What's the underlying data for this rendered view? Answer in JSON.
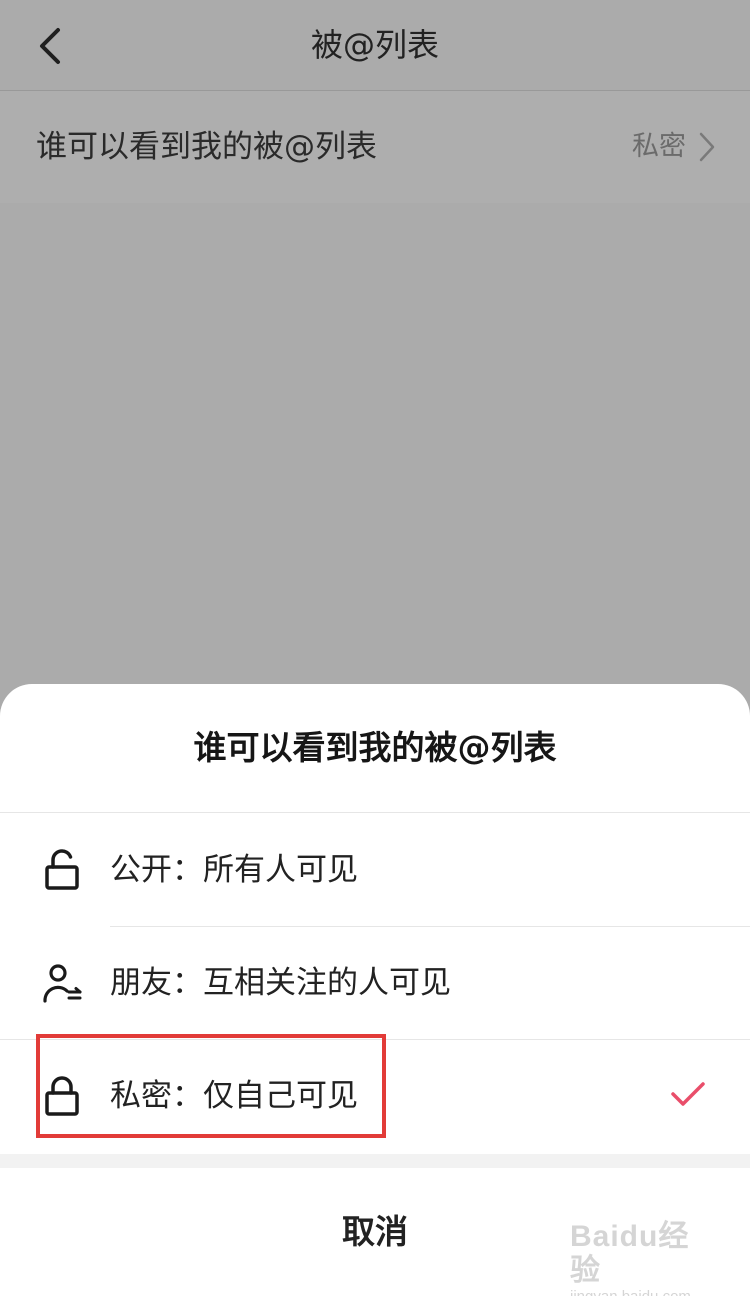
{
  "nav": {
    "title": "被@列表"
  },
  "setting": {
    "label": "谁可以看到我的被@列表",
    "value": "私密"
  },
  "sheet": {
    "title": "谁可以看到我的被@列表",
    "options": [
      {
        "label": "公开：所有人可见",
        "icon": "unlocked-icon",
        "selected": false
      },
      {
        "label": "朋友：互相关注的人可见",
        "icon": "friends-icon",
        "selected": false
      },
      {
        "label": "私密：仅自己可见",
        "icon": "lock-icon",
        "selected": true
      }
    ],
    "cancel_label": "取消"
  },
  "watermark": {
    "brand": "Baidu经验",
    "url": "jingyan.baidu.com"
  },
  "colors": {
    "overlay": "#ababab",
    "check": "#e94e6a",
    "highlight": "#e23b38"
  }
}
